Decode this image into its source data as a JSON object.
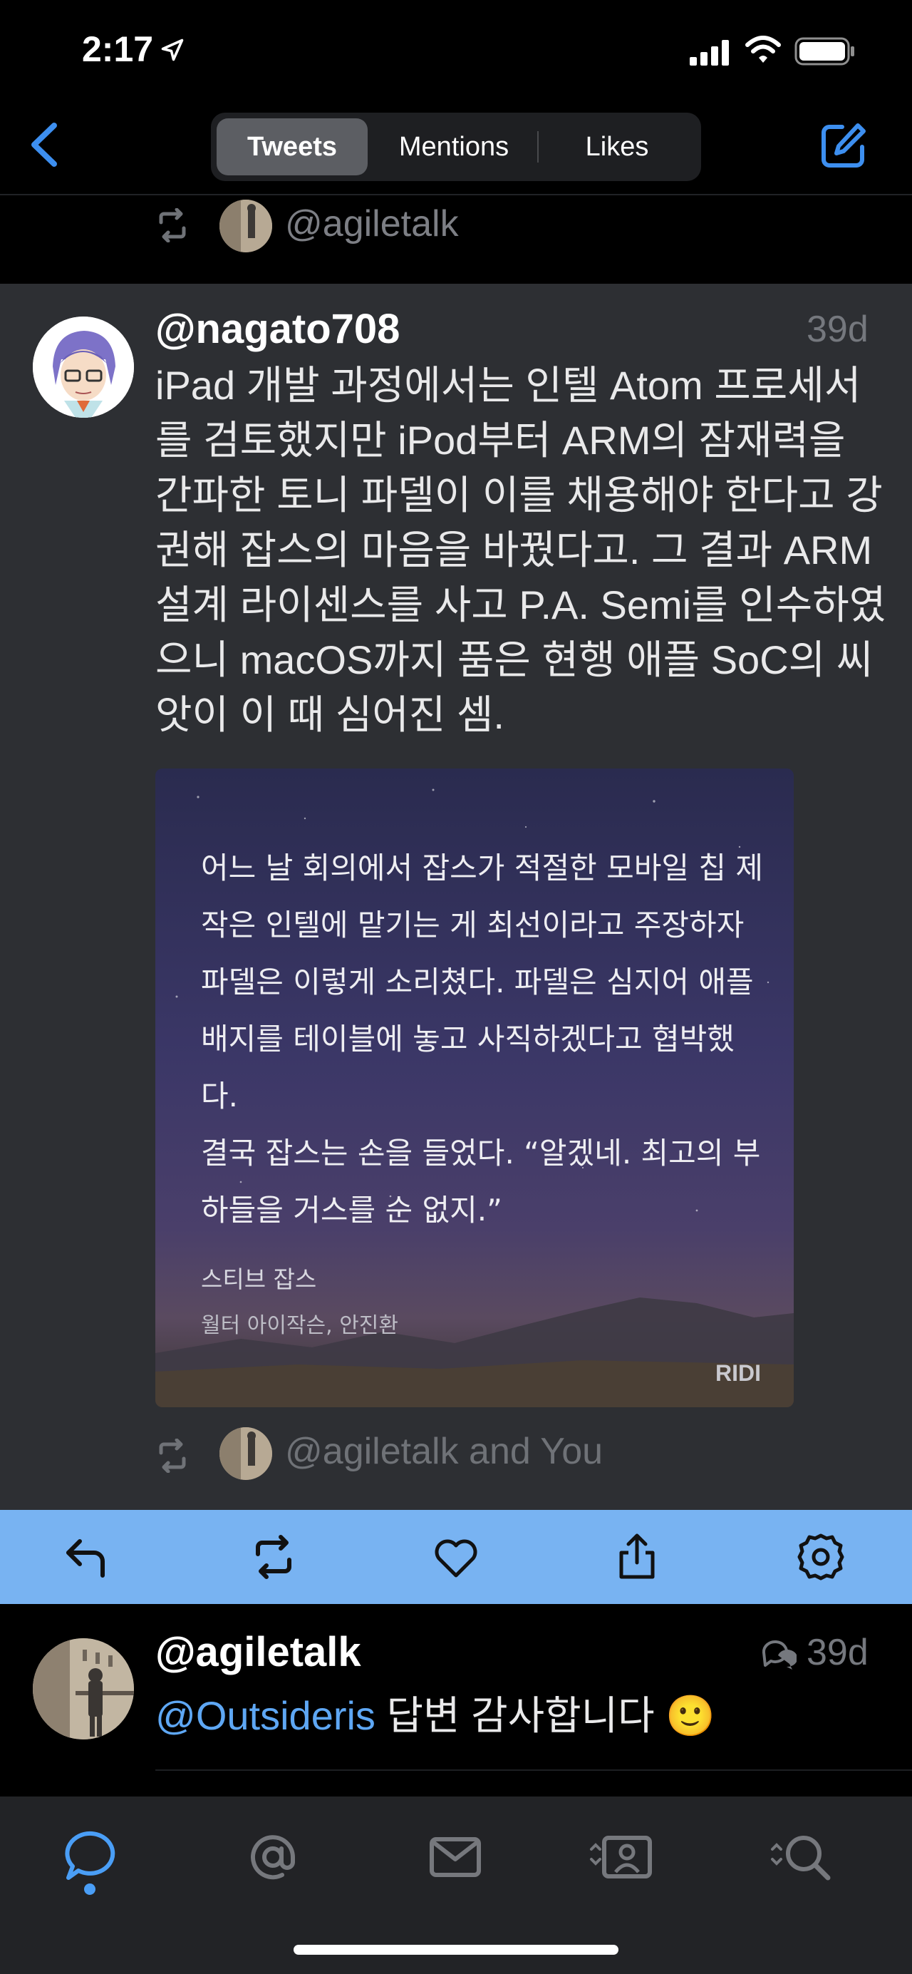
{
  "status_bar": {
    "time": "2:17"
  },
  "nav": {
    "segments": [
      "Tweets",
      "Mentions",
      "Likes"
    ],
    "selected": "Tweets"
  },
  "retweet_top": {
    "text": "@agiletalk"
  },
  "tweet": {
    "user": "@nagato708",
    "time": "39d",
    "text": "iPad 개발 과정에서는 인텔 Atom 프로세서를 검토했지만 iPod부터 ARM의 잠재력을 간파한 토니 파델이 이를 채용해야 한다고 강권해 잡스의 마음을 바꿨다고. 그 결과 ARM 설계 라이센스를 사고 P.A. Semi를 인수하였으니 macOS까지 품은 현행 애플 SoC의 씨앗이 이 때 심어진 셈.",
    "quote": {
      "text": "어느 날 회의에서 잡스가 적절한 모바일 칩 제작은 인텔에 맡기는 게 최선이라고 주장하자 파델은 이렇게 소리쳤다. 파델은 심지어 애플 배지를 테이블에 놓고 사직하겠다고 협박했다.\n결국 잡스는 손을 들었다. “알겠네. 최고의 부하들을 거스를 순 없지.”",
      "book_title": "스티브 잡스",
      "book_author": "월터 아이작슨, 안진환",
      "logo": "RIDI"
    }
  },
  "retweet_bottom": {
    "text": "@agiletalk and You"
  },
  "action_bar": {
    "icons": [
      "reply-icon",
      "retweet-icon",
      "heart-icon",
      "share-icon",
      "gear-icon"
    ],
    "background": "#78b3f2"
  },
  "tweet2": {
    "user": "@agiletalk",
    "time": "39d",
    "mention": "@Outsideris",
    "text": " 답변 감사합니다 🙂"
  },
  "tab_bar": {
    "icons": [
      "chat-bubble-icon",
      "at-sign-icon",
      "envelope-icon",
      "profile-card-icon",
      "search-icon"
    ],
    "selected": "chat-bubble-icon",
    "accent": "#4a9ef6"
  }
}
